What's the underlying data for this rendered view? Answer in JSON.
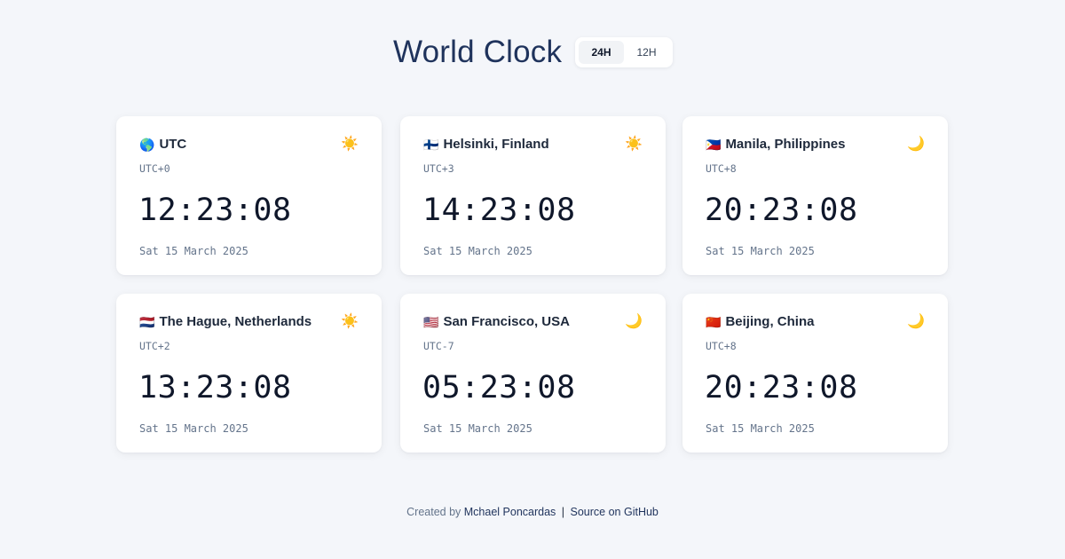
{
  "header": {
    "title": "World Clock",
    "format_toggle": {
      "options": [
        "24H",
        "12H"
      ],
      "selected": "24H"
    }
  },
  "clocks": [
    {
      "flag": "🌎",
      "city": "UTC",
      "offset": "UTC+0",
      "time": "12:23:08",
      "date": "Sat 15 March 2025",
      "daynight": "☀️",
      "period": "day"
    },
    {
      "flag": "🇫🇮",
      "city": "Helsinki, Finland",
      "offset": "UTC+3",
      "time": "14:23:08",
      "date": "Sat 15 March 2025",
      "daynight": "☀️",
      "period": "day"
    },
    {
      "flag": "🇵🇭",
      "city": "Manila, Philippines",
      "offset": "UTC+8",
      "time": "20:23:08",
      "date": "Sat 15 March 2025",
      "daynight": "🌙",
      "period": "night"
    },
    {
      "flag": "🇳🇱",
      "city": "The Hague, Netherlands",
      "offset": "UTC+2",
      "time": "13:23:08",
      "date": "Sat 15 March 2025",
      "daynight": "☀️",
      "period": "day"
    },
    {
      "flag": "🇺🇸",
      "city": "San Francisco, USA",
      "offset": "UTC-7",
      "time": "05:23:08",
      "date": "Sat 15 March 2025",
      "daynight": "🌙",
      "period": "night"
    },
    {
      "flag": "🇨🇳",
      "city": "Beijing, China",
      "offset": "UTC+8",
      "time": "20:23:08",
      "date": "Sat 15 March 2025",
      "daynight": "🌙",
      "period": "night"
    }
  ],
  "footer": {
    "created_by": "Created by",
    "author": "Mchael Poncardas",
    "separator": "|",
    "source_link": "Source on GitHub"
  },
  "colors": {
    "background": "#f4f6fa",
    "title": "#1f335c",
    "card": "#ffffff",
    "text_primary": "#0f172a",
    "text_muted": "#64748b"
  }
}
